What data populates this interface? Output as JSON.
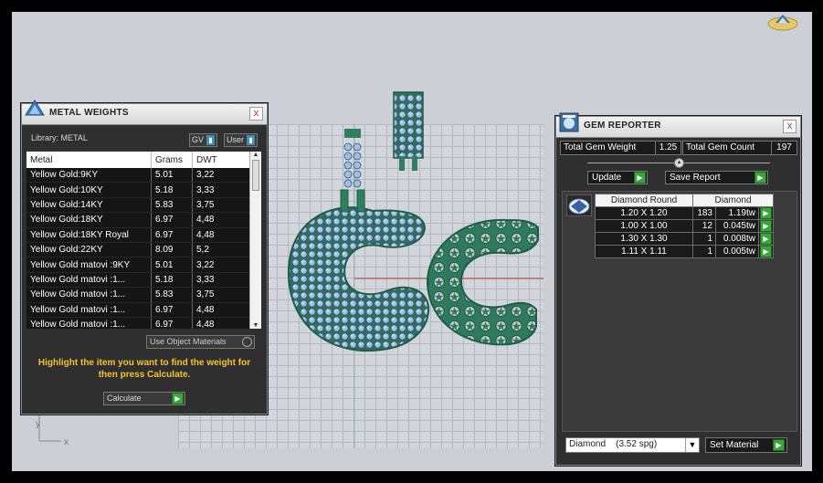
{
  "metal_weights": {
    "title": "METAL WEIGHTS",
    "close": "x",
    "library_label": "Library: METAL",
    "gv_label": "GV",
    "user_label": "User",
    "columns": [
      "Metal",
      "Grams",
      "DWT"
    ],
    "rows": [
      {
        "metal": "Yellow Gold:9KY",
        "grams": "5.01",
        "dwt": "3,22"
      },
      {
        "metal": "Yellow Gold:10KY",
        "grams": "5.18",
        "dwt": "3,33"
      },
      {
        "metal": "Yellow Gold:14KY",
        "grams": "5.83",
        "dwt": "3,75"
      },
      {
        "metal": "Yellow Gold:18KY",
        "grams": "6.97",
        "dwt": "4,48"
      },
      {
        "metal": "Yellow Gold:18KY Royal",
        "grams": "6.97",
        "dwt": "4,48"
      },
      {
        "metal": "Yellow Gold:22KY",
        "grams": "8.09",
        "dwt": "5,2"
      },
      {
        "metal": "Yellow Gold matovi :9KY",
        "grams": "5.01",
        "dwt": "3,22"
      },
      {
        "metal": "Yellow Gold matovi :1...",
        "grams": "5.18",
        "dwt": "3,33"
      },
      {
        "metal": "Yellow Gold matovi :1...",
        "grams": "5.83",
        "dwt": "3,75"
      },
      {
        "metal": "Yellow Gold matovi :1...",
        "grams": "6.97",
        "dwt": "4,48"
      },
      {
        "metal": "Yellow Gold matovi :1...",
        "grams": "6.97",
        "dwt": "4,48"
      }
    ],
    "use_object_materials": "Use Object Materials",
    "hint": "Highlight the item you want to find the weight for then press Calculate.",
    "calculate_label": "Calculate"
  },
  "gem_reporter": {
    "title": "GEM REPORTER",
    "close": "x",
    "total_gem_weight_label": "Total Gem Weight",
    "total_gem_weight_value": "1.25",
    "total_gem_count_label": "Total Gem Count",
    "total_gem_count_value": "197",
    "update_label": "Update",
    "save_report_label": "Save Report",
    "table_header_left": "Diamond Round",
    "table_header_right": "Diamond",
    "rows": [
      {
        "size": "1.20 X 1.20",
        "count": "183",
        "weight": "1.19tw"
      },
      {
        "size": "1.00 X 1.00",
        "count": "12",
        "weight": "0.045tw"
      },
      {
        "size": "1.30 X 1.30",
        "count": "1",
        "weight": "0.008tw"
      },
      {
        "size": "1.11 X 1.11",
        "count": "1",
        "weight": "0.005tw"
      }
    ],
    "material_select": "Diamond    (3.52 spg)",
    "set_material_label": "Set Material"
  },
  "axis": {
    "x": "x",
    "y": "y"
  },
  "colors": {
    "accent_green": "#39a63a",
    "model_green": "#2f7f5f",
    "hint_yellow": "#f2c431",
    "gem_blue": "#8fb3d9"
  },
  "icons": [
    "metal-weights-icon",
    "gem-reporter-icon",
    "close-icon",
    "logo-icon",
    "diamond-icon"
  ]
}
